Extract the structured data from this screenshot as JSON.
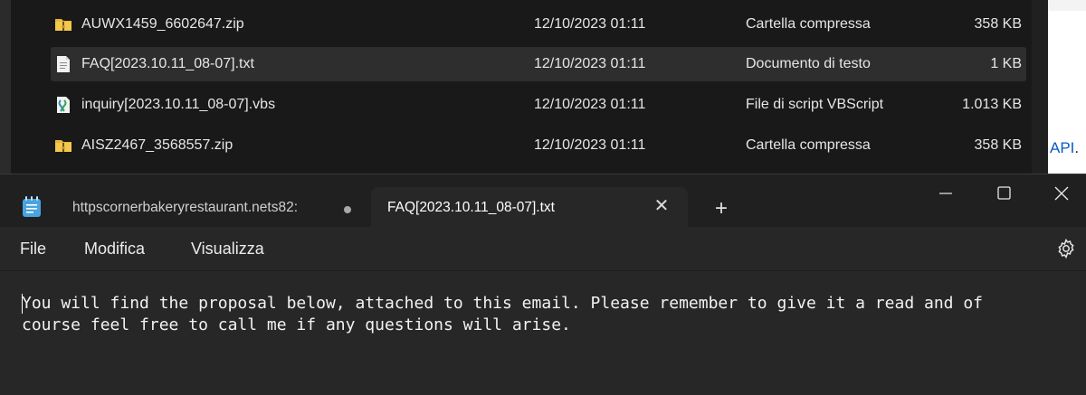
{
  "explorer": {
    "files": [
      {
        "name": "AUWX1459_6602647.zip",
        "date": "12/10/2023 01:11",
        "type": "Cartella compressa",
        "size": "358 KB",
        "icon": "zip-folder-icon"
      },
      {
        "name": "FAQ[2023.10.11_08-07].txt",
        "date": "12/10/2023 01:11",
        "type": "Documento di testo",
        "size": "1 KB",
        "icon": "text-file-icon"
      },
      {
        "name": "inquiry[2023.10.11_08-07].vbs",
        "date": "12/10/2023 01:11",
        "type": "File di script VBScript",
        "size": "1.013 KB",
        "icon": "script-file-icon"
      },
      {
        "name": "AISZ2467_3568557.zip",
        "date": "12/10/2023 01:11",
        "type": "Cartella compressa",
        "size": "358 KB",
        "icon": "zip-folder-icon"
      }
    ],
    "side_link": "API",
    "side_link_suffix": "."
  },
  "notepad": {
    "tabs": [
      {
        "label": "httpscornerbakeryrestaurant.nets82:",
        "unsaved": true
      },
      {
        "label": "FAQ[2023.10.11_08-07].txt",
        "active": true
      }
    ],
    "close_tab_symbol": "✕",
    "new_tab_symbol": "+",
    "menu": {
      "file": "File",
      "edit": "Modifica",
      "view": "Visualizza"
    },
    "content": "You will find the proposal below, attached to this email. Please remember to give it a read and of\ncourse feel free to call me if any questions will arise."
  },
  "colors": {
    "folder_yellow": "#e8b53a",
    "notepad_icon_blue": "#4aa3df",
    "link_blue": "#0a58ca"
  }
}
